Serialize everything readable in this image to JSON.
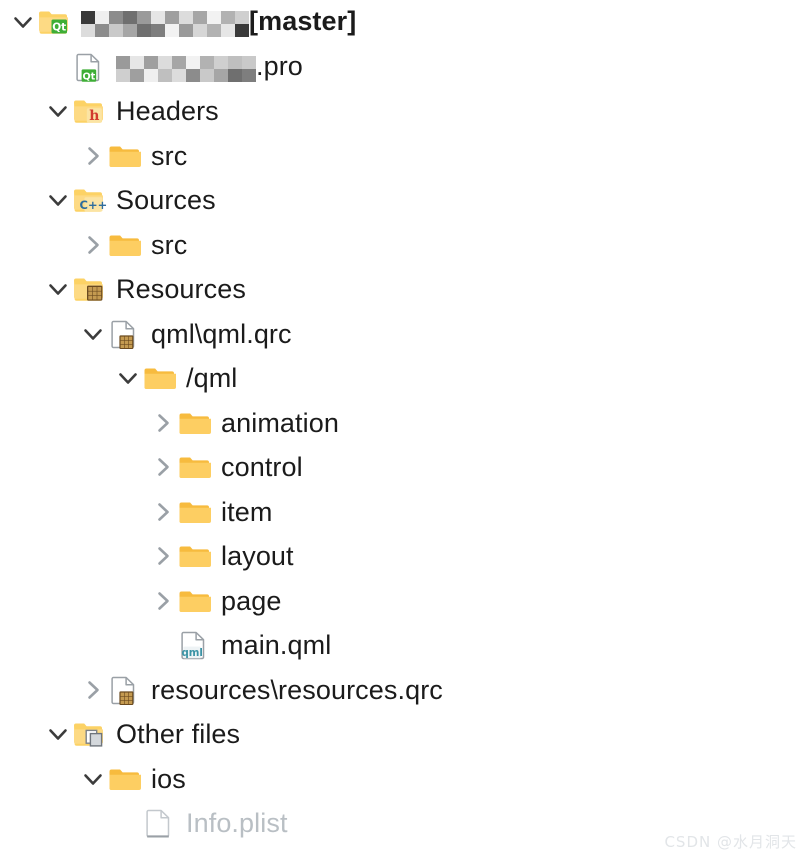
{
  "colors": {
    "text": "#1b1b1b",
    "disabled_text": "#b9bfc4",
    "folder_body": "#ffd濃",
    "folder_yellow": "#fcd265",
    "folder_yellow_dark": "#f5bb3c",
    "folder_plain": "#fbc45a",
    "qt_green": "#3eae36",
    "h_red": "#d23a2e",
    "cpp_blue": "#2f6d9e",
    "qrc_brown": "#6b4a1f",
    "qml_teal": "#3b93a5",
    "page_grey": "#9aa0a6",
    "watermark": "#e2e5e8",
    "background": "#ffffff"
  },
  "watermark": {
    "text": "CSDN @水月洞天"
  },
  "tree": {
    "name": "project-tree",
    "rows": [
      {
        "id": "project-root",
        "depth": 0,
        "expander": "expanded",
        "icon": "qt-project-folder-icon",
        "label_prefix_redacted": true,
        "redact_width": 172,
        "label": "[master]",
        "bold": true,
        "disabled": false
      },
      {
        "id": "pro-file",
        "depth": 1,
        "expander": "none",
        "icon": "qt-pro-file-icon",
        "label_prefix_redacted": true,
        "redact_width": 140,
        "label": ".pro",
        "bold": false,
        "disabled": false
      },
      {
        "id": "headers",
        "depth": 1,
        "expander": "expanded",
        "icon": "headers-folder-icon",
        "label": "Headers",
        "bold": false,
        "disabled": false
      },
      {
        "id": "headers-src",
        "depth": 2,
        "expander": "collapsed",
        "icon": "plain-folder-icon",
        "label": "src",
        "bold": false,
        "disabled": false
      },
      {
        "id": "sources",
        "depth": 1,
        "expander": "expanded",
        "icon": "sources-folder-icon",
        "label": "Sources",
        "bold": false,
        "disabled": false
      },
      {
        "id": "sources-src",
        "depth": 2,
        "expander": "collapsed",
        "icon": "plain-folder-icon",
        "label": "src",
        "bold": false,
        "disabled": false
      },
      {
        "id": "resources",
        "depth": 1,
        "expander": "expanded",
        "icon": "resources-folder-icon",
        "label": "Resources",
        "bold": false,
        "disabled": false
      },
      {
        "id": "qml-qrc",
        "depth": 2,
        "expander": "expanded",
        "icon": "qrc-file-icon",
        "label": "qml\\qml.qrc",
        "bold": false,
        "disabled": false
      },
      {
        "id": "qml-prefix",
        "depth": 3,
        "expander": "expanded",
        "icon": "plain-folder-icon",
        "label": "/qml",
        "bold": false,
        "disabled": false
      },
      {
        "id": "animation",
        "depth": 4,
        "expander": "collapsed",
        "icon": "plain-folder-icon",
        "label": "animation",
        "bold": false,
        "disabled": false
      },
      {
        "id": "control",
        "depth": 4,
        "expander": "collapsed",
        "icon": "plain-folder-icon",
        "label": "control",
        "bold": false,
        "disabled": false
      },
      {
        "id": "item",
        "depth": 4,
        "expander": "collapsed",
        "icon": "plain-folder-icon",
        "label": "item",
        "bold": false,
        "disabled": false
      },
      {
        "id": "layout",
        "depth": 4,
        "expander": "collapsed",
        "icon": "plain-folder-icon",
        "label": "layout",
        "bold": false,
        "disabled": false
      },
      {
        "id": "page",
        "depth": 4,
        "expander": "collapsed",
        "icon": "plain-folder-icon",
        "label": "page",
        "bold": false,
        "disabled": false
      },
      {
        "id": "main-qml",
        "depth": 4,
        "expander": "none",
        "icon": "qml-file-icon",
        "label": "main.qml",
        "bold": false,
        "disabled": false
      },
      {
        "id": "resources-qrc",
        "depth": 2,
        "expander": "collapsed",
        "icon": "qrc-file-icon",
        "label": "resources\\resources.qrc",
        "bold": false,
        "disabled": false
      },
      {
        "id": "other-files",
        "depth": 1,
        "expander": "expanded",
        "icon": "other-files-folder-icon",
        "label": "Other files",
        "bold": false,
        "disabled": false
      },
      {
        "id": "ios",
        "depth": 2,
        "expander": "expanded",
        "icon": "plain-folder-icon",
        "label": "ios",
        "bold": false,
        "disabled": false
      },
      {
        "id": "info-plist",
        "depth": 3,
        "expander": "none",
        "icon": "plain-file-icon",
        "label": "Info.plist",
        "bold": false,
        "disabled": true
      }
    ]
  }
}
